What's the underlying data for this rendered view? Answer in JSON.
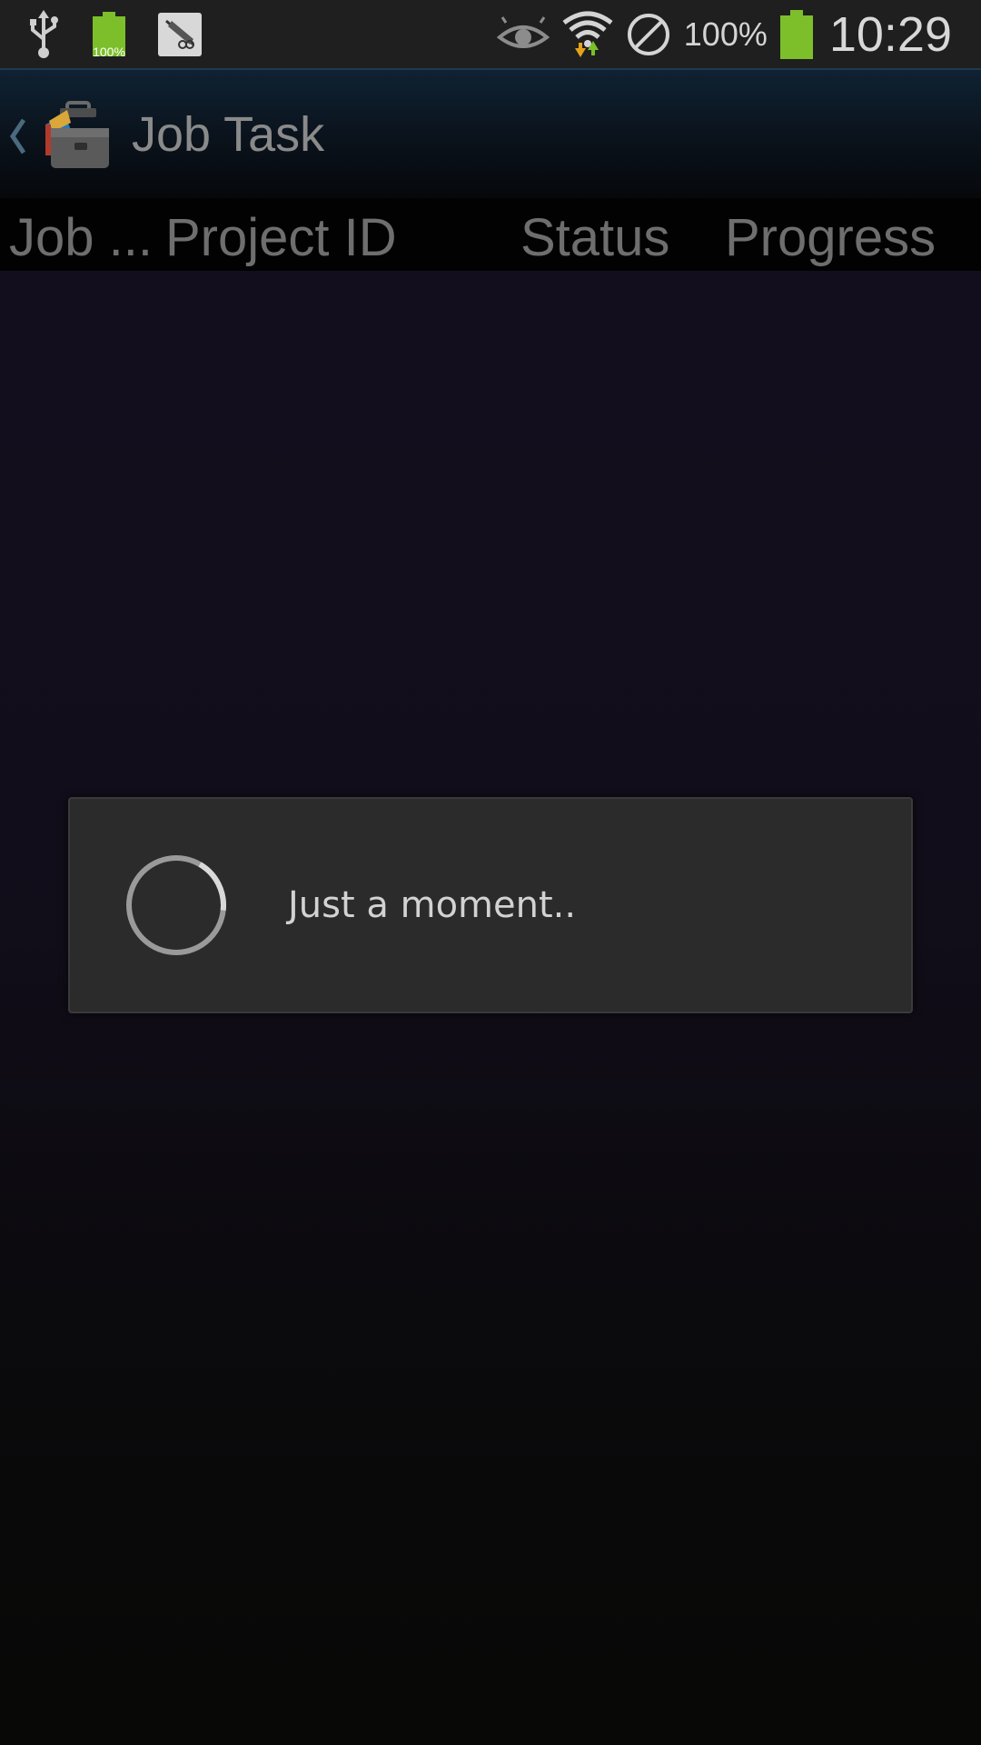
{
  "status_bar": {
    "left_icons": [
      "usb-icon",
      "battery-full-icon",
      "app-notification-icon"
    ],
    "small_battery_percent": "100%",
    "right_icons": [
      "eye-icon",
      "wifi-icon",
      "blocked-icon",
      "battery-icon"
    ],
    "battery_percent": "100%",
    "time": "10:29",
    "battery_color": "#7cbf2a"
  },
  "action_bar": {
    "back_icon": "chevron-left-icon",
    "app_icon": "toolbox-icon",
    "title": "Job Task"
  },
  "table_header": {
    "columns": [
      {
        "label": "Job ..."
      },
      {
        "label": "Project ID"
      },
      {
        "label": "Status"
      },
      {
        "label": "Progress"
      }
    ]
  },
  "dialog": {
    "icon": "loading-spinner-icon",
    "message": "Just a moment.."
  }
}
